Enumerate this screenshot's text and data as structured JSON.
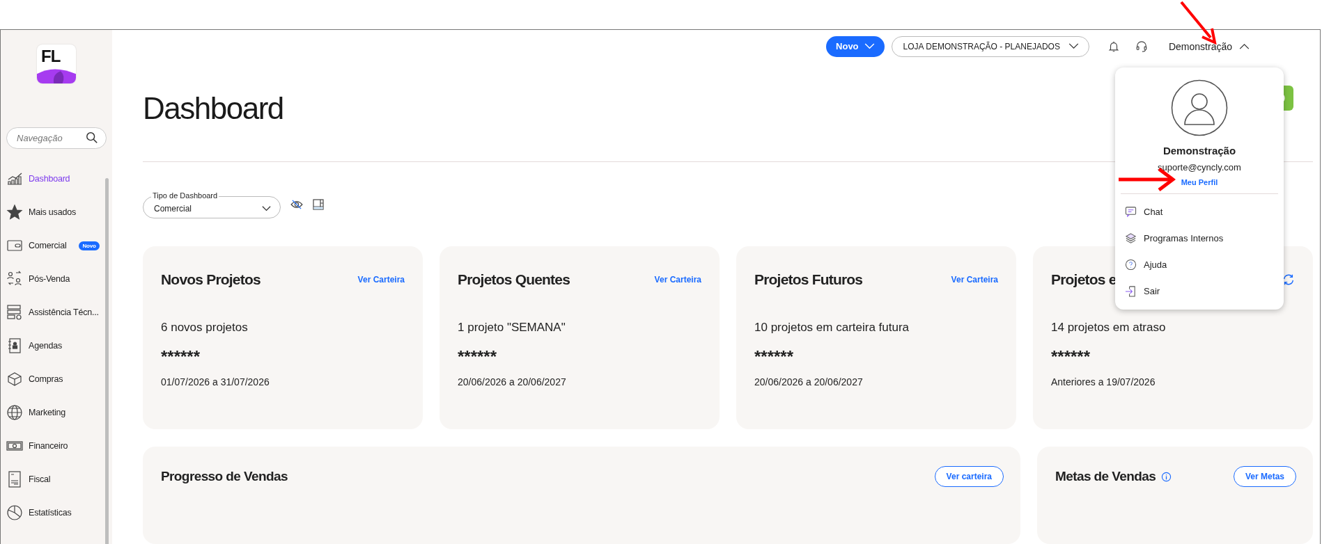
{
  "sidebar": {
    "logo": "FL",
    "search": {
      "placeholder": "Navegação"
    },
    "items": [
      {
        "label": "Dashboard",
        "selected": true
      },
      {
        "label": "Mais usados",
        "selected": false
      },
      {
        "label": "Comercial",
        "selected": false,
        "badge": "Novo"
      },
      {
        "label": "Pós-Venda",
        "selected": false
      },
      {
        "label": "Assistência Técn...",
        "selected": false
      },
      {
        "label": "Agendas",
        "selected": false
      },
      {
        "label": "Compras",
        "selected": false
      },
      {
        "label": "Marketing",
        "selected": false
      },
      {
        "label": "Financeiro",
        "selected": false
      },
      {
        "label": "Fiscal",
        "selected": false
      },
      {
        "label": "Estatísticas",
        "selected": false
      }
    ]
  },
  "topbar": {
    "new_button": "Novo",
    "store_select": "LOJA DEMONSTRAÇÃO - PLANEJADOS",
    "user": "Demonstração",
    "user_menu_expanded": true
  },
  "user_menu": {
    "name": "Demonstração",
    "email": "suporte@cyncly.com",
    "profile_link": "Meu Perfil",
    "items": [
      {
        "label": "Chat"
      },
      {
        "label": "Programas Internos"
      },
      {
        "label": "Ajuda"
      },
      {
        "label": "Sair"
      }
    ]
  },
  "page": {
    "title": "Dashboard",
    "dashboard_type": {
      "label": "Tipo de Dashboard",
      "value": "Comercial"
    }
  },
  "cards": [
    {
      "title": "Novos Projetos",
      "action": {
        "kind": "link",
        "label": "Ver Carteira"
      },
      "summary": "6 novos projetos",
      "masked": "******",
      "period": "01/07/2026 a 31/07/2026"
    },
    {
      "title": "Projetos Quentes",
      "action": {
        "kind": "link",
        "label": "Ver Carteira"
      },
      "summary": "1 projeto \"SEMANA\"",
      "masked": "******",
      "period": "20/06/2026 a 20/06/2027"
    },
    {
      "title": "Projetos Futuros",
      "action": {
        "kind": "link",
        "label": "Ver Carteira"
      },
      "summary": "10 projetos em carteira futura",
      "masked": "******",
      "period": "20/06/2026 a 20/06/2027"
    },
    {
      "title": "Projetos e",
      "action": {
        "kind": "refresh"
      },
      "summary": "14 projetos em atraso",
      "masked": "******",
      "period": "Anteriores a 19/07/2026"
    }
  ],
  "panels": [
    {
      "title": "Progresso de Vendas",
      "info": false,
      "button": "Ver carteira"
    },
    {
      "title": "Metas de Vendas",
      "info": true,
      "button": "Ver Metas"
    }
  ]
}
